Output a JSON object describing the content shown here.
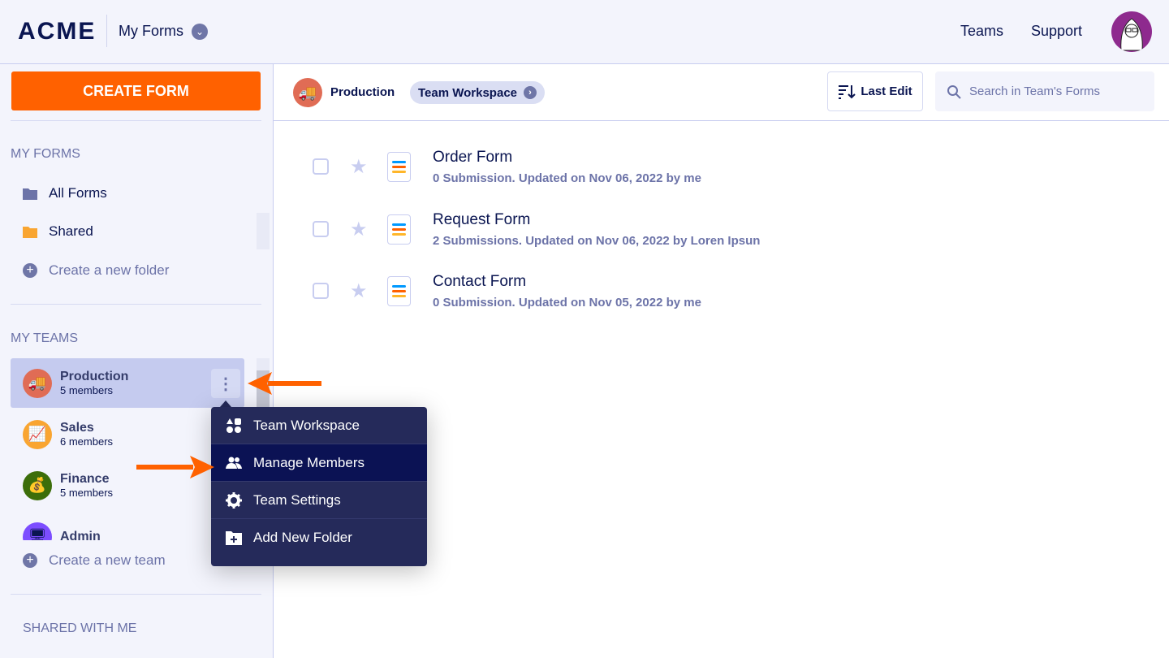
{
  "header": {
    "logo": "ACME",
    "my_forms": "My Forms",
    "nav": [
      "Teams",
      "Support"
    ]
  },
  "sidebar": {
    "create_form": "CREATE FORM",
    "my_forms_heading": "MY FORMS",
    "folders": [
      {
        "label": "All Forms",
        "icon": "folder-icon",
        "color": "#6c73a8"
      },
      {
        "label": "Shared",
        "icon": "folder-icon",
        "color": "#f9a531"
      }
    ],
    "create_folder": "Create a new folder",
    "my_teams_heading": "MY TEAMS",
    "teams": [
      {
        "name": "Production",
        "members": "5 members",
        "icon": "truck-icon",
        "color": "#e06c55",
        "selected": true
      },
      {
        "name": "Sales",
        "members": "6 members",
        "icon": "chart-icon",
        "color": "#f9a531"
      },
      {
        "name": "Finance",
        "members": "5 members",
        "icon": "money-bag-icon",
        "color": "#3c6e0a"
      },
      {
        "name": "Admin",
        "members": "",
        "icon": "monitor-icon",
        "color": "#7c4dff"
      }
    ],
    "create_team": "Create a new team",
    "shared_heading": "SHARED WITH ME"
  },
  "toolbar": {
    "team": "Production",
    "workspace": "Team Workspace",
    "sort": "Last Edit",
    "search_placeholder": "Search in Team's Forms"
  },
  "forms": [
    {
      "title": "Order Form",
      "meta": "0 Submission. Updated on Nov 06, 2022 by me"
    },
    {
      "title": "Request Form",
      "meta": "2 Submissions. Updated on Nov 06, 2022 by Loren Ipsun"
    },
    {
      "title": "Contact Form",
      "meta": "0 Submission. Updated on Nov 05, 2022 by me"
    }
  ],
  "menu": {
    "items": [
      "Team Workspace",
      "Manage Members",
      "Team Settings",
      "Add New Folder"
    ],
    "highlighted": "Manage Members"
  },
  "colors": {
    "accent": "#ff6100",
    "navy": "#0a1551",
    "menu_bg": "#252a5a",
    "menu_highlight": "#0b1254"
  }
}
